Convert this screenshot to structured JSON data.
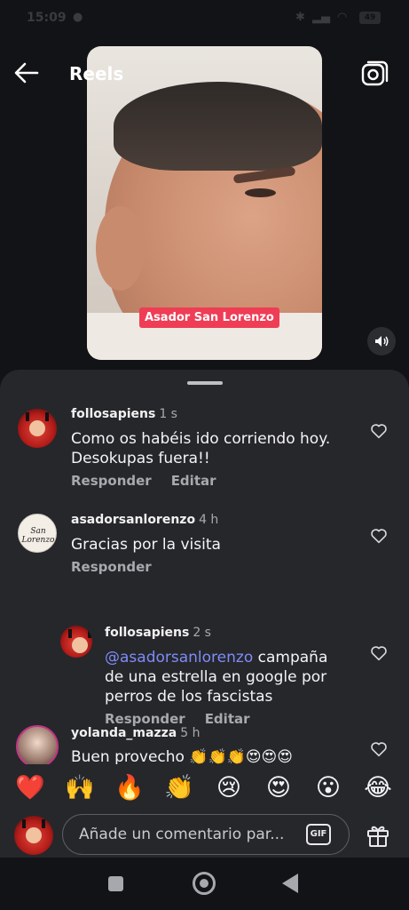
{
  "status": {
    "time": "15:09",
    "battery": "49"
  },
  "header": {
    "title": "Reels"
  },
  "video": {
    "caption_tag": "Asador San Lorenzo"
  },
  "comments": [
    {
      "username": "follosapiens",
      "time": "1 s",
      "text": "Como os habéis ido corriendo hoy. Desokupas fuera!!",
      "reply_label": "Responder",
      "edit_label": "Editar"
    },
    {
      "username": "asadorsanlorenzo",
      "time": "4 h",
      "text": "Gracias por la visita",
      "reply_label": "Responder",
      "avatar_text": "San Lorenzo"
    },
    {
      "username": "follosapiens",
      "time": "2 s",
      "mention": "@asadorsanlorenzo",
      "text": " campaña de una estrella en google por perros de los fascistas",
      "reply_label": "Responder",
      "edit_label": "Editar"
    },
    {
      "username": "yolanda_mazza",
      "time": "5 h",
      "text": "Buen provecho 👏👏👏😍😍😍"
    }
  ],
  "emoji_reactions": [
    "❤️",
    "🙌",
    "🔥",
    "👏",
    "😢",
    "😍",
    "😮",
    "😂"
  ],
  "composer": {
    "placeholder": "Añade un comentario par...",
    "gif_label": "GIF"
  },
  "colors": {
    "accent_tag": "#ef3d55",
    "mention": "#7f8cf6",
    "sheet_bg": "#26272b"
  }
}
